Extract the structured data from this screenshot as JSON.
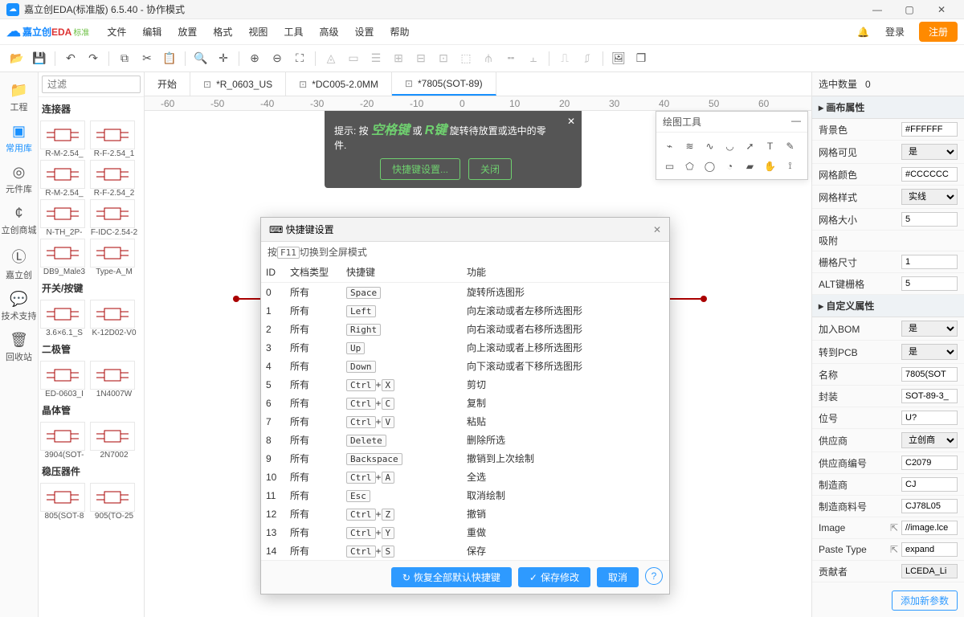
{
  "title": "嘉立创EDA(标准版) 6.5.40 - 协作模式",
  "logo": {
    "brand": "嘉立创",
    "eda": "EDA",
    "sub": "标准"
  },
  "menus": [
    "文件",
    "编辑",
    "放置",
    "格式",
    "视图",
    "工具",
    "高级",
    "设置",
    "帮助"
  ],
  "login": "登录",
  "register": "注册",
  "rail": [
    {
      "icon": "📁",
      "label": "工程"
    },
    {
      "icon": "▣",
      "label": "常用库"
    },
    {
      "icon": "◎",
      "label": "元件库"
    },
    {
      "icon": "¢",
      "label": "立创商城"
    },
    {
      "icon": "Ⓛ",
      "label": "嘉立创"
    },
    {
      "icon": "💬",
      "label": "技术支持"
    },
    {
      "icon": "🗑",
      "label": "回收站"
    }
  ],
  "filter_ph": "过滤",
  "lib": [
    {
      "cat": "连接器",
      "items": [
        "R-M-2.54_",
        "R-F-2.54_1",
        "R-M-2.54_",
        "R-F-2.54_2",
        "N-TH_2P-",
        "F-IDC-2.54-2",
        "DB9_Male3",
        "Type-A_M"
      ]
    },
    {
      "cat": "开关/按键",
      "items": [
        "3.6×6.1_S",
        "K-12D02-V0"
      ]
    },
    {
      "cat": "二极管",
      "items": [
        "ED-0603_I",
        "1N4007W"
      ]
    },
    {
      "cat": "晶体管",
      "items": [
        "3904(SOT-",
        "2N7002"
      ]
    },
    {
      "cat": "稳压器件",
      "items": [
        "805(SOT-8",
        "905(TO-25"
      ]
    }
  ],
  "tabs": [
    {
      "label": "开始",
      "dirty": false
    },
    {
      "label": "*R_0603_US",
      "dirty": true
    },
    {
      "label": "*DC005-2.0MM",
      "dirty": true
    },
    {
      "label": "*7805(SOT-89)",
      "dirty": true,
      "active": true
    }
  ],
  "ruler": [
    "-60",
    "-50",
    "-40",
    "-30",
    "-20",
    "-10",
    "0",
    "10",
    "20",
    "30",
    "40",
    "50",
    "60"
  ],
  "hint": {
    "prefix": "提示: 按 ",
    "k1": "空格键",
    "mid": "或",
    "k2": "R键",
    "suffix": "旋转待放置或选中的零件.",
    "btn_settings": "快捷键设置...",
    "btn_close": "关闭"
  },
  "draw_title": "绘图工具",
  "dialog": {
    "title": "快捷键设置",
    "hint_pre": "按",
    "hint_key": "F11",
    "hint_post": "切换到全屏模式",
    "cols": [
      "ID",
      "文档类型",
      "快捷键",
      "功能"
    ],
    "rows": [
      {
        "id": "0",
        "t": "所有",
        "k": [
          "Space"
        ],
        "f": "旋转所选图形"
      },
      {
        "id": "1",
        "t": "所有",
        "k": [
          "Left"
        ],
        "f": "向左滚动或者左移所选图形"
      },
      {
        "id": "2",
        "t": "所有",
        "k": [
          "Right"
        ],
        "f": "向右滚动或者右移所选图形"
      },
      {
        "id": "3",
        "t": "所有",
        "k": [
          "Up"
        ],
        "f": "向上滚动或者上移所选图形"
      },
      {
        "id": "4",
        "t": "所有",
        "k": [
          "Down"
        ],
        "f": "向下滚动或者下移所选图形"
      },
      {
        "id": "5",
        "t": "所有",
        "k": [
          "Ctrl",
          "X"
        ],
        "f": "剪切"
      },
      {
        "id": "6",
        "t": "所有",
        "k": [
          "Ctrl",
          "C"
        ],
        "f": "复制"
      },
      {
        "id": "7",
        "t": "所有",
        "k": [
          "Ctrl",
          "V"
        ],
        "f": "粘贴"
      },
      {
        "id": "8",
        "t": "所有",
        "k": [
          "Delete"
        ],
        "f": "删除所选"
      },
      {
        "id": "9",
        "t": "所有",
        "k": [
          "Backspace"
        ],
        "f": "撤销到上次绘制"
      },
      {
        "id": "10",
        "t": "所有",
        "k": [
          "Ctrl",
          "A"
        ],
        "f": "全选"
      },
      {
        "id": "11",
        "t": "所有",
        "k": [
          "Esc"
        ],
        "f": "取消绘制"
      },
      {
        "id": "12",
        "t": "所有",
        "k": [
          "Ctrl",
          "Z"
        ],
        "f": "撤销"
      },
      {
        "id": "13",
        "t": "所有",
        "k": [
          "Ctrl",
          "Y"
        ],
        "f": "重做"
      },
      {
        "id": "14",
        "t": "所有",
        "k": [
          "Ctrl",
          "S"
        ],
        "f": "保存"
      }
    ],
    "btn_restore": "恢复全部默认快捷键",
    "btn_save": "保存修改",
    "btn_cancel": "取消"
  },
  "sel_count_label": "选中数量",
  "sel_count": "0",
  "rp_canvas": "画布属性",
  "rp_custom": "自定义属性",
  "props_canvas": [
    {
      "l": "背景色",
      "v": "#FFFFFF",
      "t": "text"
    },
    {
      "l": "网格可见",
      "v": "是",
      "t": "select"
    },
    {
      "l": "网格颜色",
      "v": "#CCCCCC",
      "t": "text"
    },
    {
      "l": "网格样式",
      "v": "实线",
      "t": "select"
    },
    {
      "l": "网格大小",
      "v": "5",
      "t": "text"
    },
    {
      "l": "吸附",
      "v": "",
      "t": "none"
    },
    {
      "l": "栅格尺寸",
      "v": "1",
      "t": "text"
    },
    {
      "l": "ALT键栅格",
      "v": "5",
      "t": "text"
    }
  ],
  "props_custom": [
    {
      "l": "加入BOM",
      "v": "是",
      "t": "select"
    },
    {
      "l": "转到PCB",
      "v": "是",
      "t": "select"
    },
    {
      "l": "名称",
      "v": "7805(SOT",
      "t": "text"
    },
    {
      "l": "封装",
      "v": "SOT-89-3_",
      "t": "text"
    },
    {
      "l": "位号",
      "v": "U?",
      "t": "text"
    },
    {
      "l": "供应商",
      "v": "立创商",
      "t": "select"
    },
    {
      "l": "供应商编号",
      "v": "C2079",
      "t": "text"
    },
    {
      "l": "制造商",
      "v": "CJ",
      "t": "text"
    },
    {
      "l": "制造商料号",
      "v": "CJ78L05",
      "t": "text"
    },
    {
      "l": "Image",
      "v": "//image.lce",
      "t": "text",
      "link": true
    },
    {
      "l": "Paste Type",
      "v": "expand",
      "t": "text",
      "link": true
    },
    {
      "l": "贡献者",
      "v": "LCEDA_Li",
      "t": "text",
      "ro": true
    }
  ],
  "add_param": "添加新参数"
}
